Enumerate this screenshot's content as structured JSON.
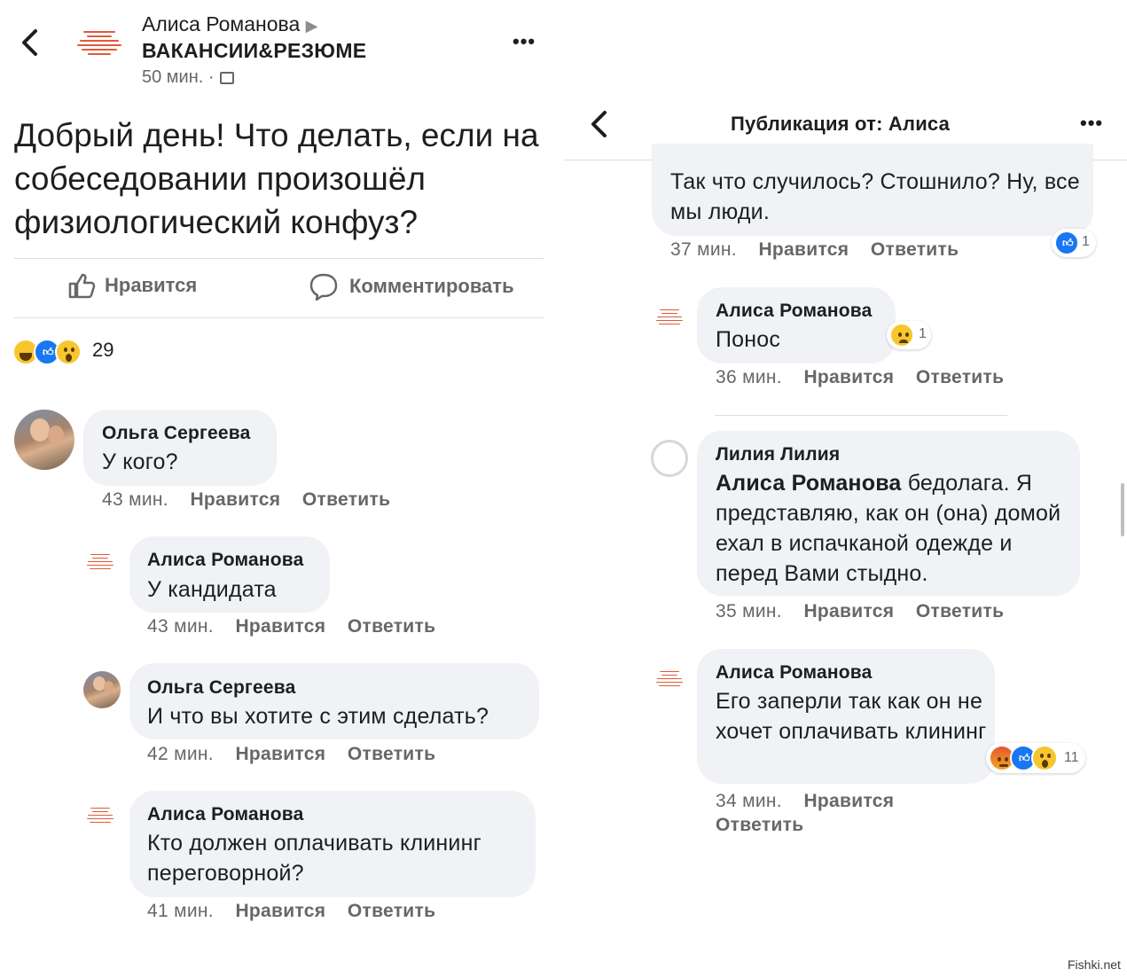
{
  "left": {
    "header": {
      "author": "Алиса Романова",
      "group": "ВАКАНСИИ&РЕЗЮМЕ",
      "time": "50 мин. ·",
      "more": "•••"
    },
    "post_text": "Добрый день! Что делать, если на собеседовании произошёл физиологический конфуз?",
    "actions": {
      "like": "Нравится",
      "comment": "Комментировать"
    },
    "reaction_count": "29",
    "comments": [
      {
        "author": "Ольга Сергеева",
        "text": "У кого?",
        "time": "43 мин.",
        "like": "Нравится",
        "reply": "Ответить"
      },
      {
        "author": "Алиса Романова",
        "text": "У кандидата",
        "time": "43 мин.",
        "like": "Нравится",
        "reply": "Ответить"
      },
      {
        "author": "Ольга Сергеева",
        "text": "И что вы хотите с этим сделать?",
        "time": "42 мин.",
        "like": "Нравится",
        "reply": "Ответить"
      },
      {
        "author": "Алиса Романова",
        "text": "Кто должен оплачивать клининг переговорной?",
        "time": "41 мин.",
        "like": "Нравится",
        "reply": "Ответить"
      }
    ]
  },
  "right": {
    "header": {
      "title": "Публикация от: Алиса",
      "more": "•••"
    },
    "comments": [
      {
        "text": "Так что случилось? Стошнило? Ну, все мы люди.",
        "time": "37 мин.",
        "like": "Нравится",
        "reply": "Ответить",
        "reactions": "1"
      },
      {
        "author": "Алиса Романова",
        "text": "Понос",
        "time": "36 мин.",
        "like": "Нравится",
        "reply": "Ответить",
        "reactions": "1"
      },
      {
        "author": "Лилия Лилия",
        "mention": "Алиса Романова",
        "text": " бедолага. Я представляю, как он (она) домой ехал в испачканой одежде и перед Вами стыдно.",
        "time": "35 мин.",
        "like": "Нравится",
        "reply": "Ответить"
      },
      {
        "author": "Алиса Романова",
        "text": "Его заперли так как он не хочет оплачивать клининг",
        "time": "34 мин.",
        "like": "Нравится",
        "reply": "Ответить",
        "reactions": "11"
      }
    ]
  },
  "watermark": "Fishki.net"
}
